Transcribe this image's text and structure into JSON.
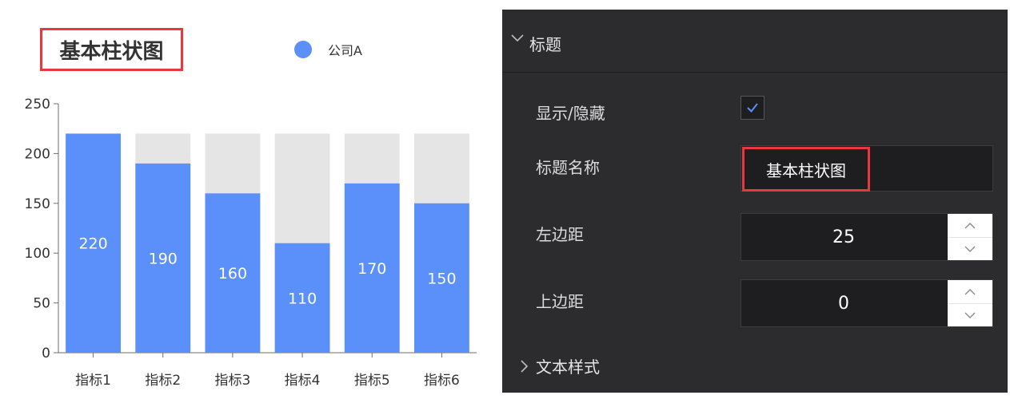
{
  "chart_data": {
    "type": "bar",
    "title": "基本柱状图",
    "categories": [
      "指标1",
      "指标2",
      "指标3",
      "指标4",
      "指标5",
      "指标6"
    ],
    "series": [
      {
        "name": "公司A",
        "values": [
          220,
          190,
          160,
          110,
          170,
          150
        ]
      }
    ],
    "background_max": 220,
    "ylim": [
      0,
      250
    ],
    "yticks": [
      0,
      50,
      100,
      150,
      200,
      250
    ],
    "ytick_labels": [
      "0",
      "50",
      "100",
      "150",
      "200",
      "250"
    ],
    "xlabel": "",
    "ylabel": "",
    "grid": false,
    "legend_position": "top",
    "data_labels": true,
    "colors": {
      "bar": "#5b8ff9",
      "bar_background": "#e5e5e5",
      "axis": "#6e6e6e",
      "text": "#333333",
      "highlight": "#e5383f"
    }
  },
  "panel": {
    "section_title": "标题",
    "fields": {
      "visible": {
        "label": "显示/隐藏",
        "checked": true
      },
      "title_name": {
        "label": "标题名称",
        "value": "基本柱状图"
      },
      "left_margin": {
        "label": "左边距",
        "value": "25"
      },
      "top_margin": {
        "label": "上边距",
        "value": "0"
      }
    },
    "collapsed_section": "文本样式",
    "icons": [
      "chevron-down-icon",
      "check-icon",
      "chevron-up-icon",
      "chevron-right-icon"
    ],
    "colors": {
      "background": "#2c2c2e",
      "input_background": "#1e1e20",
      "check": "#5b8ff9",
      "highlight": "#e5383f"
    }
  }
}
